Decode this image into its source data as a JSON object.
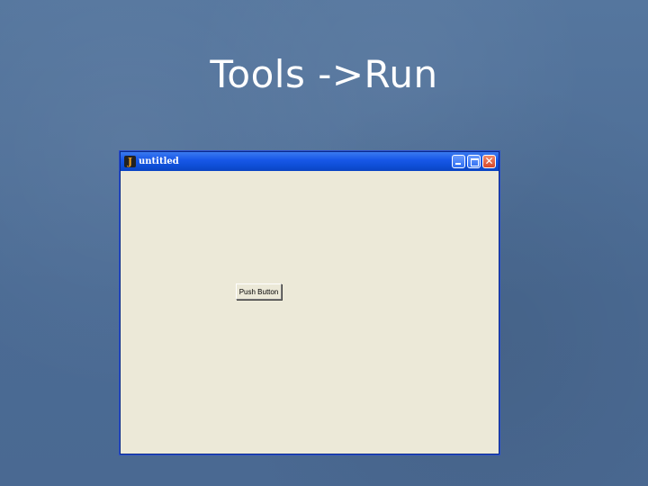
{
  "slide": {
    "title": "Tools ->Run"
  },
  "window": {
    "title": "untitled",
    "app_icon": "matlab-figure-icon",
    "controls": {
      "minimize": "minimize-icon",
      "maximize": "maximize-icon",
      "close": "close-icon",
      "close_glyph": "✕"
    }
  },
  "content": {
    "push_button_label": "Push Button"
  },
  "colors": {
    "background": "#4f6f98",
    "titlebar": "#1858e8",
    "client": "#ece9d8"
  }
}
